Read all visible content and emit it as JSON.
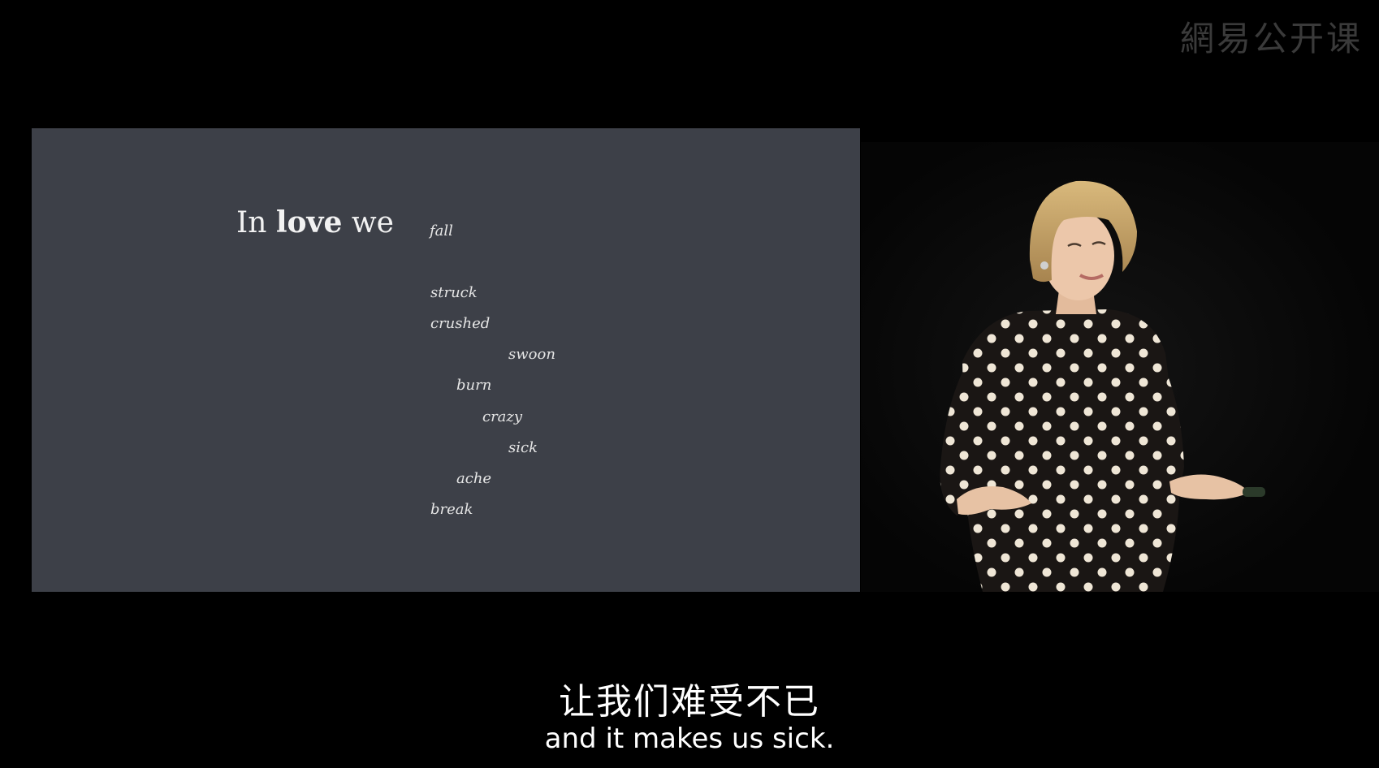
{
  "watermark": "網易公开课",
  "slide": {
    "lead_prefix": "In ",
    "lead_bold": "love",
    "lead_suffix": " we",
    "words": [
      "fall",
      "struck",
      "crushed",
      "swoon",
      "burn",
      "crazy",
      "sick",
      "ache",
      "break"
    ]
  },
  "subtitles": {
    "zh": "让我们难受不已",
    "en": "and it makes us sick."
  },
  "colors": {
    "slide_background": "#3d4048",
    "frame_background": "#000000",
    "slide_text": "#f2f2f2"
  }
}
